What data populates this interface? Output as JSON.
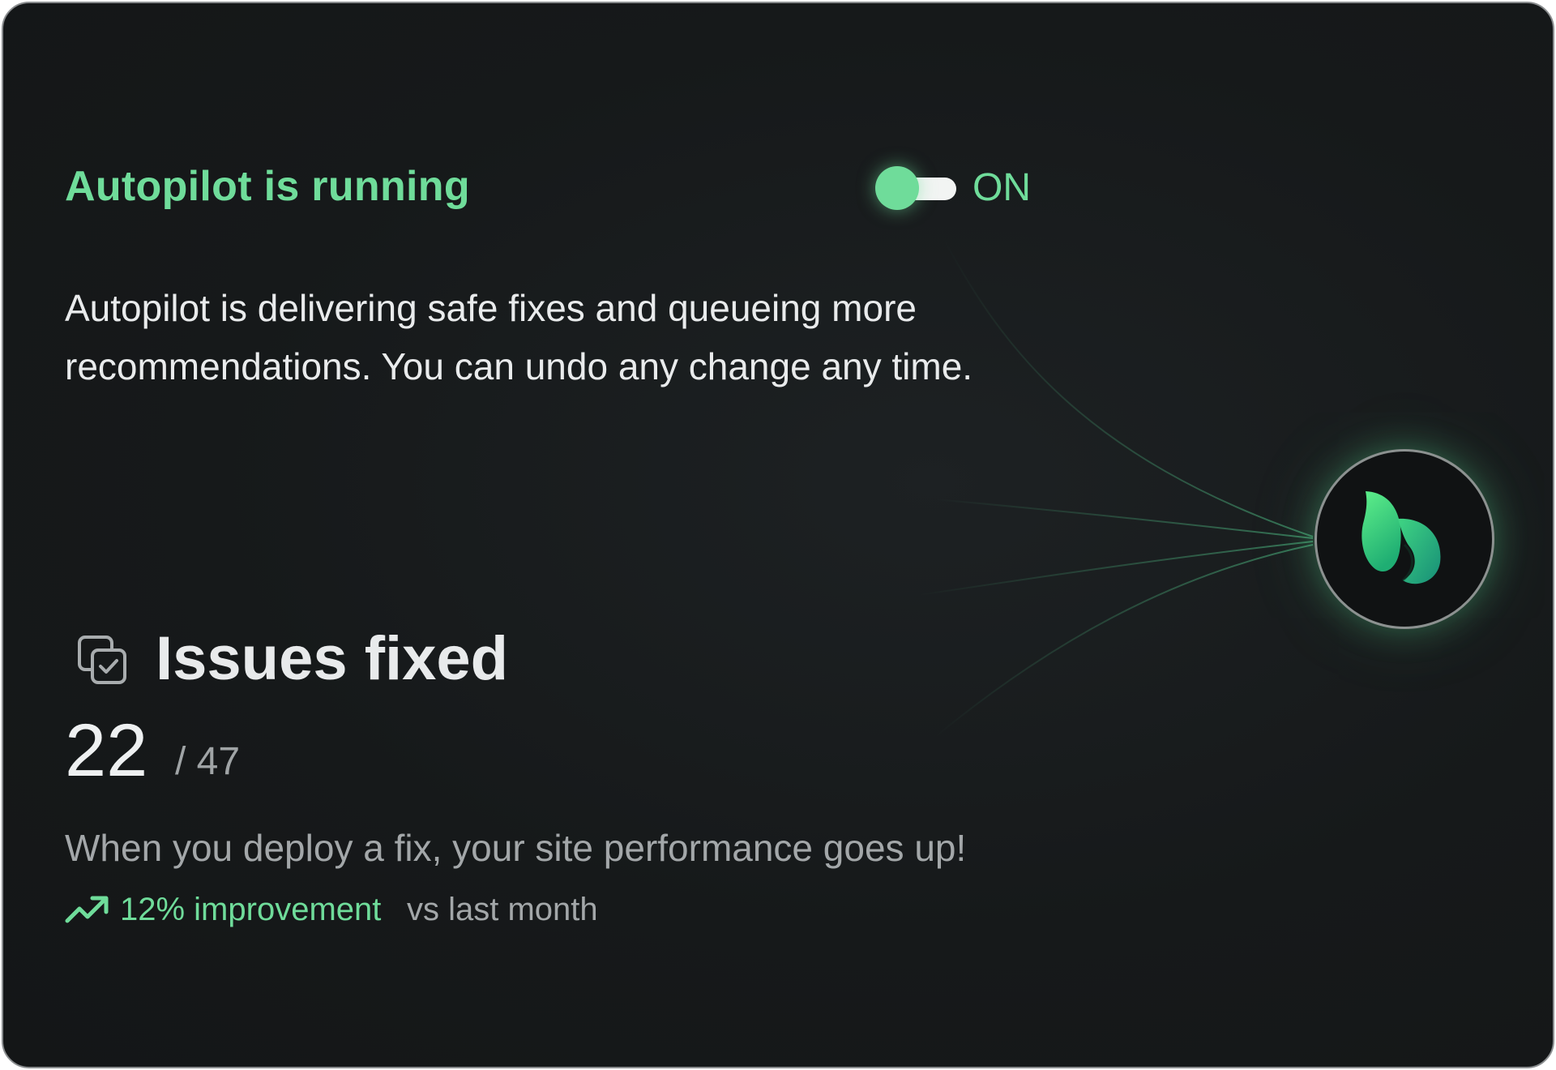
{
  "header": {
    "title": "Autopilot is running",
    "toggle_state": "ON",
    "toggle_on": true
  },
  "description": "Autopilot is delivering safe fixes and queueing more recommendations. You can undo any change any time.",
  "logo": {
    "icon": "leaf-logo-icon"
  },
  "issues": {
    "title": "Issues fixed",
    "icon": "checked-copy-icon",
    "fixed": "22",
    "total": "/ 47",
    "message": "When you deploy a fix, your site performance goes up!"
  },
  "trend": {
    "icon": "trending-up-icon",
    "value": "12% improvement",
    "comparison": "vs last month"
  },
  "colors": {
    "accent": "#6fdc9a",
    "background": "#16191a",
    "text_primary": "#e9ebec",
    "text_secondary": "#a3a7a9"
  }
}
